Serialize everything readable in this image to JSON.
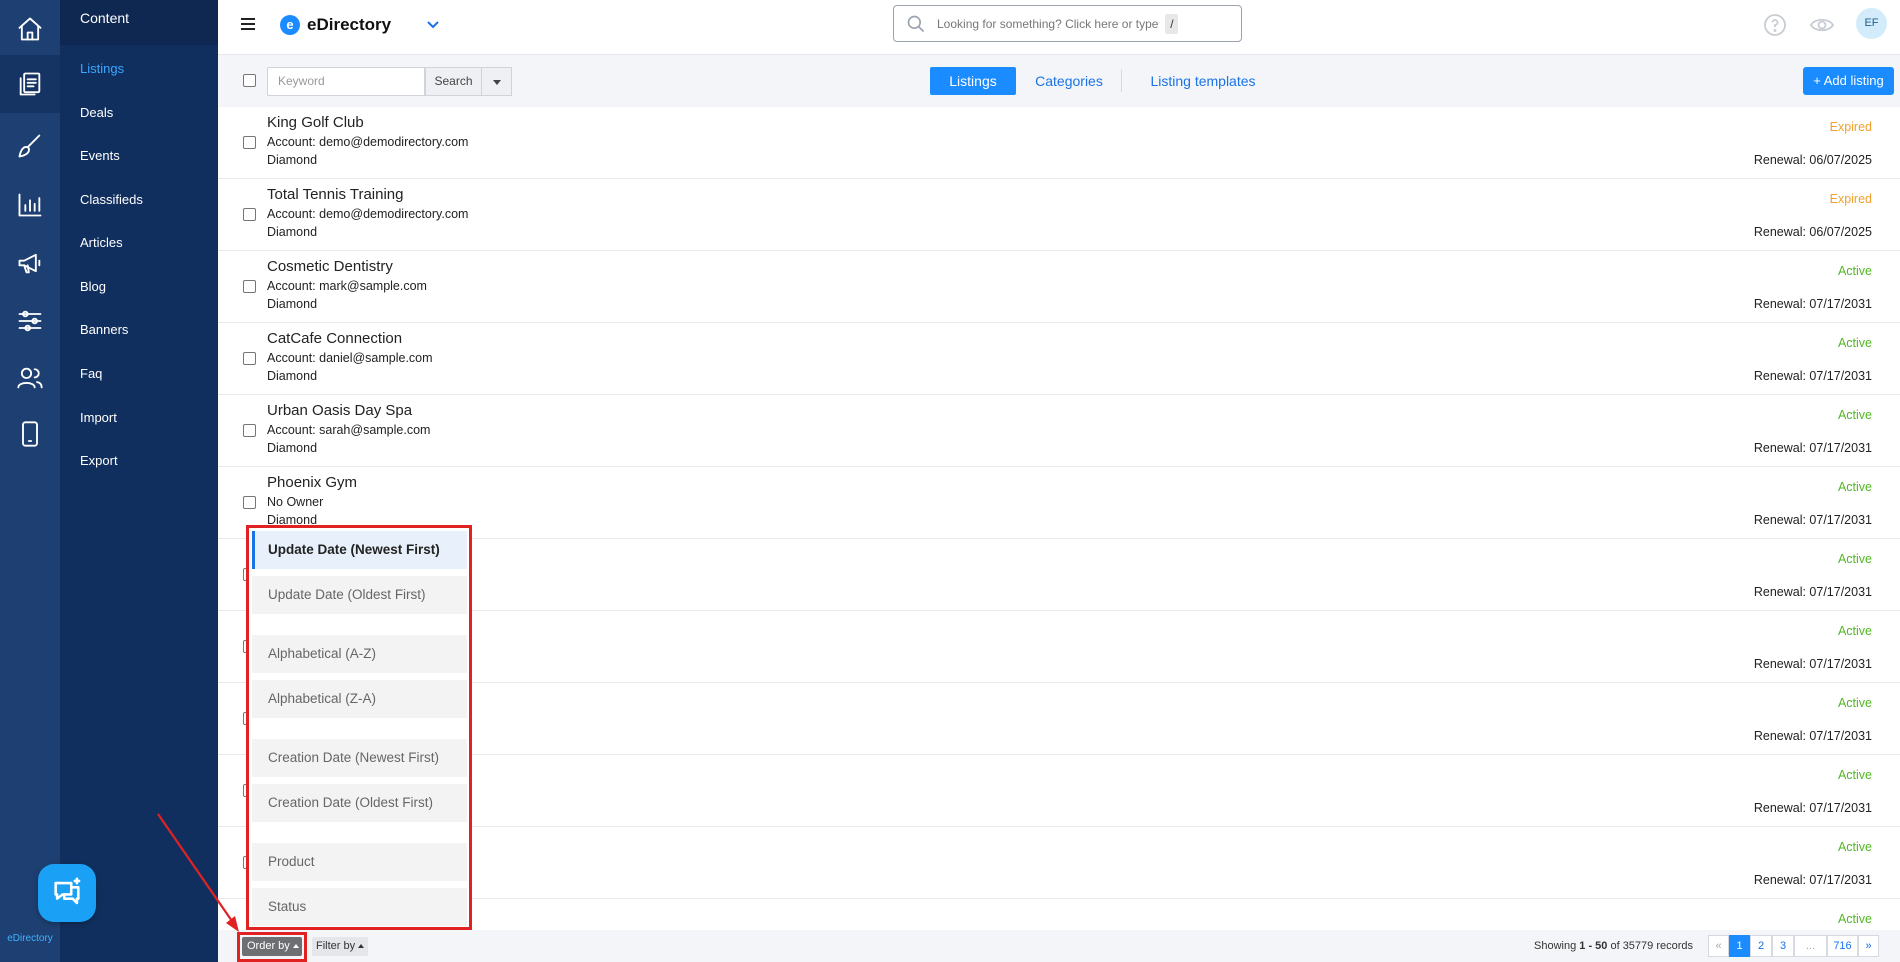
{
  "rail": {
    "items": [
      {
        "name": "home-icon"
      },
      {
        "name": "content-icon"
      },
      {
        "name": "design-icon"
      },
      {
        "name": "reports-icon"
      },
      {
        "name": "promote-icon"
      },
      {
        "name": "settings-icon"
      },
      {
        "name": "users-icon"
      },
      {
        "name": "mobile-icon"
      }
    ],
    "brand_text": "eDirectory",
    "chat_icon": "chat-bubble-icon"
  },
  "submenu": {
    "title": "Content",
    "items": [
      {
        "label": "Listings",
        "active": true
      },
      {
        "label": "Deals"
      },
      {
        "label": "Events"
      },
      {
        "label": "Classifieds"
      },
      {
        "label": "Articles"
      },
      {
        "label": "Blog"
      },
      {
        "label": "Banners"
      },
      {
        "label": "Faq"
      },
      {
        "label": "Import"
      },
      {
        "label": "Export"
      }
    ]
  },
  "header": {
    "brand_name": "eDirectory",
    "brand_logo_letter": "e",
    "search_placeholder": "Looking for something? Click here or type",
    "search_shortcut": "/",
    "avatar_initials": "EF"
  },
  "toolbar": {
    "keyword_placeholder": "Keyword",
    "search_label": "Search",
    "tabs": [
      {
        "label": "Listings",
        "active": true
      },
      {
        "label": "Categories"
      },
      {
        "label": "Listing templates"
      }
    ],
    "add_label": "+ Add listing"
  },
  "listings": [
    {
      "title": "King Golf Club",
      "account": "Account: demo@demodirectory.com",
      "level": "Diamond",
      "status": "Expired",
      "renewal": "Renewal: 06/07/2025"
    },
    {
      "title": "Total Tennis Training",
      "account": "Account: demo@demodirectory.com",
      "level": "Diamond",
      "status": "Expired",
      "renewal": "Renewal: 06/07/2025"
    },
    {
      "title": "Cosmetic Dentistry",
      "account": "Account: mark@sample.com",
      "level": "Diamond",
      "status": "Active",
      "renewal": "Renewal: 07/17/2031"
    },
    {
      "title": "CatCafe Connection",
      "account": "Account: daniel@sample.com",
      "level": "Diamond",
      "status": "Active",
      "renewal": "Renewal: 07/17/2031"
    },
    {
      "title": "Urban Oasis Day Spa",
      "account": "Account: sarah@sample.com",
      "level": "Diamond",
      "status": "Active",
      "renewal": "Renewal: 07/17/2031"
    },
    {
      "title": "Phoenix Gym",
      "account": "No Owner",
      "level": "Diamond",
      "status": "Active",
      "renewal": "Renewal: 07/17/2031"
    },
    {
      "title": "",
      "account": "",
      "level": "",
      "status": "Active",
      "renewal": "Renewal: 07/17/2031"
    },
    {
      "title": "",
      "account": "",
      "level": "",
      "status": "Active",
      "renewal": "Renewal: 07/17/2031"
    },
    {
      "title": "",
      "account": "",
      "level": "",
      "status": "Active",
      "renewal": "Renewal: 07/17/2031"
    },
    {
      "title": "",
      "account": "",
      "level": "",
      "status": "Active",
      "renewal": "Renewal: 07/17/2031"
    },
    {
      "title": "",
      "account": "",
      "level": "",
      "status": "Active",
      "renewal": "Renewal: 07/17/2031"
    },
    {
      "title": "",
      "account": "",
      "level": "",
      "status": "Active",
      "renewal": ""
    }
  ],
  "order_menu": {
    "options": [
      {
        "label": "Update Date (Newest First)",
        "selected": true
      },
      {
        "label": "Update Date (Oldest First)"
      },
      {
        "label": "Alphabetical (A-Z)"
      },
      {
        "label": "Alphabetical (Z-A)"
      },
      {
        "label": "Creation Date (Newest First)"
      },
      {
        "label": "Creation Date (Oldest First)"
      },
      {
        "label": "Product"
      },
      {
        "label": "Status"
      }
    ]
  },
  "footer": {
    "order_by_label": "Order by",
    "filter_by_label": "Filter by",
    "records_prefix": "Showing ",
    "records_range": "1 - 50",
    "records_of": " of 35779 records",
    "pagination": [
      "«",
      "1",
      "2",
      "3",
      "...",
      "716",
      "»"
    ]
  },
  "colors": {
    "rail_bg": "#1e3f72",
    "submenu_bg": "#112f5e",
    "accent": "#1a8cff",
    "expired": "#f0a12c",
    "active": "#55b526",
    "annotation": "#e02222"
  }
}
